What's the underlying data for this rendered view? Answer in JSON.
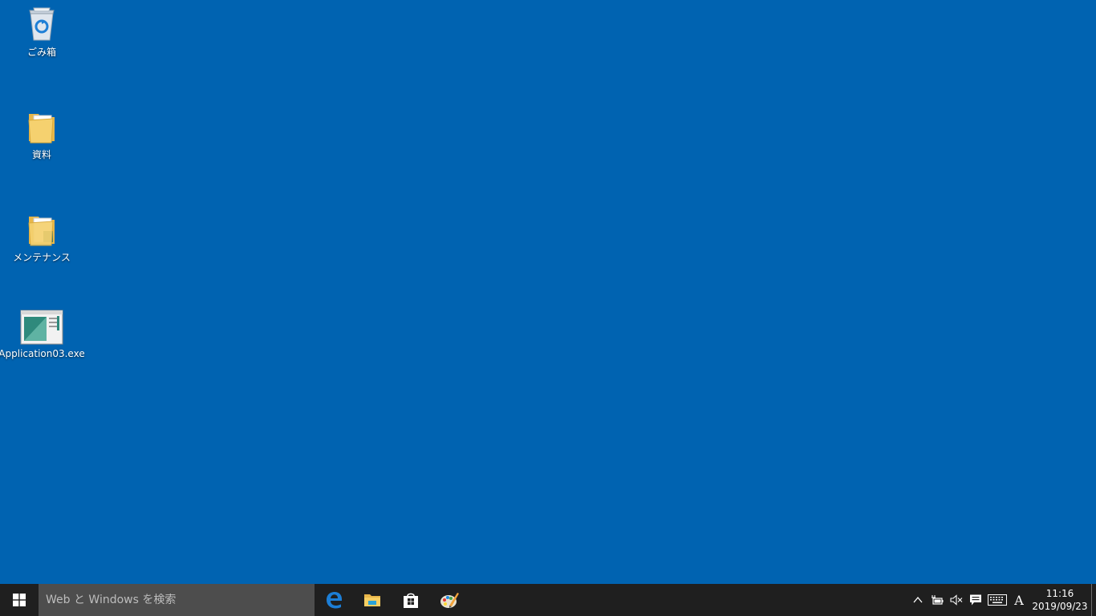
{
  "desktop": {
    "icons": [
      {
        "label": "ごみ箱",
        "icon": "recycle-bin-icon"
      },
      {
        "label": "資料",
        "icon": "folder-icon"
      },
      {
        "label": "メンテナンス",
        "icon": "folder-icon"
      },
      {
        "label": "Application03.exe",
        "icon": "application-window-icon"
      }
    ]
  },
  "taskbar": {
    "search_placeholder": "Web と Windows を検索",
    "pinned": [
      "edge-icon",
      "file-explorer-icon",
      "store-icon",
      "paint-icon"
    ],
    "tray": {
      "ime_mode": "A",
      "time": "11:16",
      "date": "2019/09/23"
    }
  },
  "colors": {
    "desktop_background": "#0063b1",
    "taskbar": "#1f1f1f",
    "search_box": "#4d4d4d"
  }
}
